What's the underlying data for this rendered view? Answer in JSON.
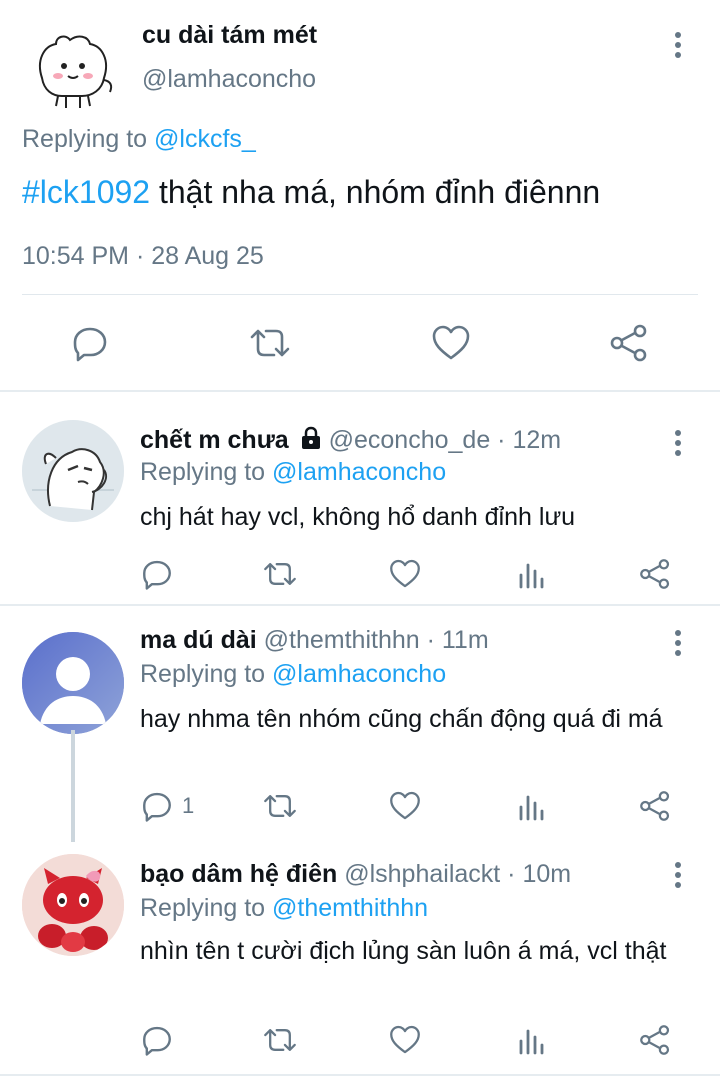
{
  "main_tweet": {
    "name": "cu dài tám mét",
    "handle": "@lamhaconcho",
    "replying_prefix": "Replying to",
    "replying_to": "@lckcfs_",
    "hashtag": "#lck1092",
    "text": " thật nha má, nhóm đỉnh điênnn",
    "timestamp": "10:54 PM · 28 Aug 25",
    "actions": [
      "reply-icon",
      "retweet-icon",
      "like-icon",
      "share-icon"
    ]
  },
  "replies": [
    {
      "name": "chết m chưa",
      "locked": true,
      "meta": "@econcho_de · 12m",
      "replying_prefix": "Replying to",
      "replying_to": "@lamhaconcho",
      "text": "chj hát hay vcl, không hổ danh đỉnh lưu",
      "reply_count": "",
      "avatar": "sketch-dog-avatar"
    },
    {
      "name": "ma dú dài",
      "locked": false,
      "meta": "@themthithhn · 11m",
      "replying_prefix": "Replying to",
      "replying_to": "@lamhaconcho",
      "text": "hay nhma tên nhóm cũng chấn động quá đi má",
      "reply_count": "1",
      "avatar": "default-user-avatar"
    },
    {
      "name": "bạo dâm hệ điên",
      "locked": false,
      "meta": "@lshphailackt · 10m",
      "replying_prefix": "Replying to",
      "replying_to": "@themthithhn",
      "text": "nhìn tên t cười địch lủng sàn luôn á má, vcl thật",
      "reply_count": "",
      "avatar": "strawberry-kitty-avatar"
    }
  ],
  "colors": {
    "accent": "#1da1f2",
    "muted": "#657786",
    "divider": "#e6ecf0",
    "icon": "#657786"
  }
}
